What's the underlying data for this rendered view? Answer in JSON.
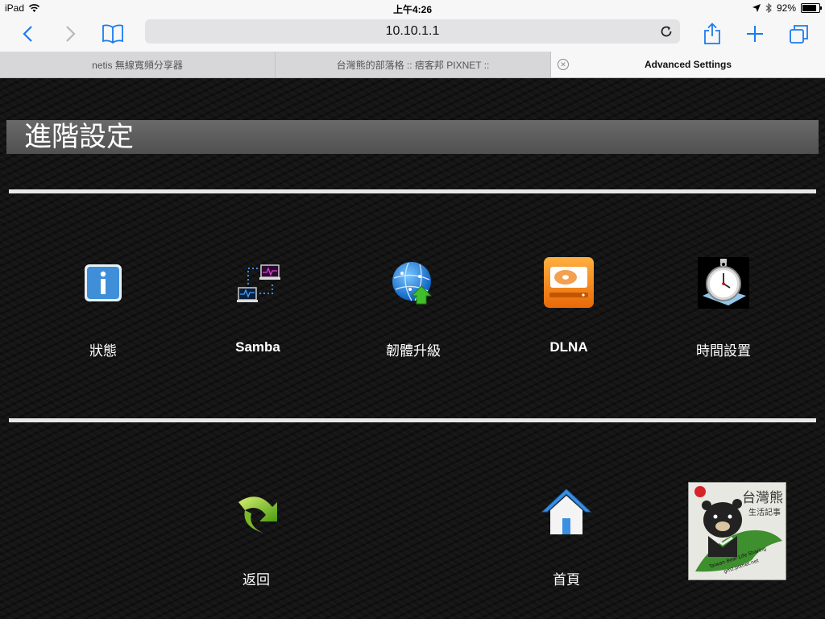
{
  "status_bar": {
    "device": "iPad",
    "time": "上午4:26",
    "battery": "92%",
    "battery_level": 0.92
  },
  "toolbar": {
    "url": "10.10.1.1"
  },
  "tabs": [
    {
      "label": "netis 無線寬頻分享器",
      "active": false
    },
    {
      "label": "台灣熊的部落格 :: 痞客邦 PIXNET ::",
      "active": false
    },
    {
      "label": "Advanced Settings",
      "active": true
    }
  ],
  "page": {
    "title": "進階設定",
    "menu": [
      {
        "label": "狀態",
        "icon": "info-icon"
      },
      {
        "label": "Samba",
        "icon": "network-computers-icon"
      },
      {
        "label": "韌體升級",
        "icon": "globe-upgrade-icon"
      },
      {
        "label": "DLNA",
        "icon": "hard-drive-icon"
      },
      {
        "label": "時間設置",
        "icon": "stopwatch-icon"
      }
    ],
    "nav": [
      {
        "label": "返回",
        "icon": "back-arrow-icon"
      },
      {
        "label": "首頁",
        "icon": "home-icon"
      }
    ],
    "watermark": {
      "brand": "台灣熊",
      "subtitle": "生活記事",
      "caption": "Taiwan Bear Life Sharing",
      "url": "gmz.pixnet.net"
    }
  },
  "colors": {
    "title_bar": "#5a5a5a",
    "divider": "#e8e8e8",
    "ios_blue": "#1a7cf0"
  }
}
